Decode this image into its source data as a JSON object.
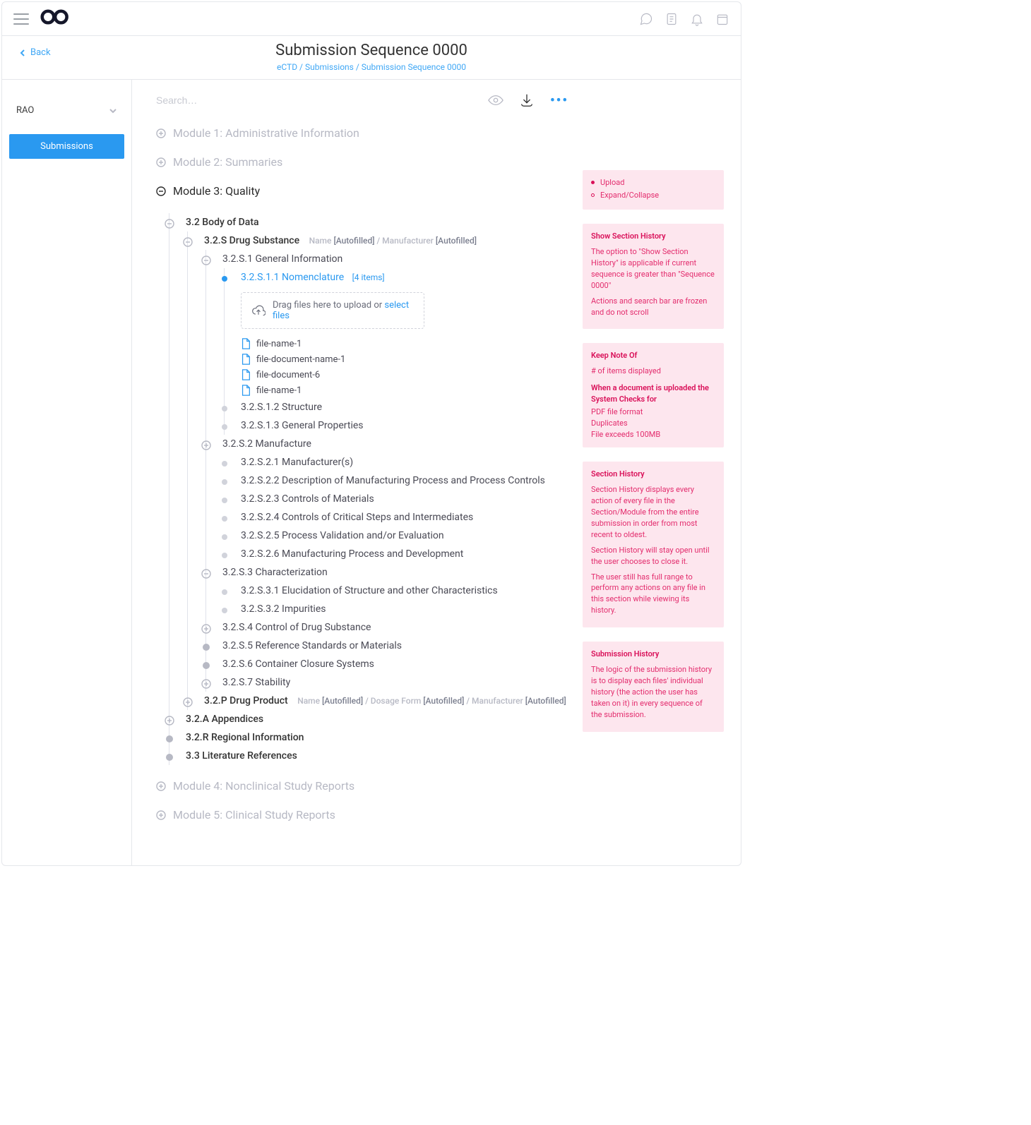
{
  "header": {
    "page_title": "Submission Sequence 0000",
    "breadcrumbs": "eCTD / Submissions / Submission Sequence 0000",
    "back_label": "Back"
  },
  "sidebar": {
    "project": "RAO",
    "nav": [
      "Submissions"
    ]
  },
  "toolbar": {
    "search_placeholder": "Search…"
  },
  "modules": {
    "m1": "Module 1: Administrative Information",
    "m2": "Module 2: Summaries",
    "m3": "Module 3: Quality",
    "m4": "Module 4: Nonclinical Study Reports",
    "m5": "Module 5: Clinical Study Reports"
  },
  "tree": {
    "l_3_2": "3.2 Body of Data",
    "l_3_2_s": "3.2.S Drug Substance",
    "l_3_2_s_meta1_label": "Name",
    "l_3_2_s_meta1_val": "[Autofilled]",
    "l_3_2_s_meta2_label": "Manufacturer",
    "l_3_2_s_meta2_val": "[Autofilled]",
    "l_3_2_s_1": "3.2.S.1 General Information",
    "l_3_2_s_1_1": "3.2.S.1.1 Nomenclature",
    "l_3_2_s_1_1_count": "[4 items]",
    "l_3_2_s_1_2": "3.2.S.1.2 Structure",
    "l_3_2_s_1_3": "3.2.S.1.3 General Properties",
    "l_3_2_s_2": "3.2.S.2 Manufacture",
    "l_3_2_s_2_1": "3.2.S.2.1 Manufacturer(s)",
    "l_3_2_s_2_2": "3.2.S.2.2 Description of Manufacturing Process and Process Controls",
    "l_3_2_s_2_3": "3.2.S.2.3 Controls of Materials",
    "l_3_2_s_2_4": "3.2.S.2.4 Controls of Critical Steps and Intermediates",
    "l_3_2_s_2_5": "3.2.S.2.5 Process Validation and/or Evaluation",
    "l_3_2_s_2_6": "3.2.S.2.6 Manufacturing Process and Development",
    "l_3_2_s_3": "3.2.S.3 Characterization",
    "l_3_2_s_3_1": "3.2.S.3.1 Elucidation of Structure and other Characteristics",
    "l_3_2_s_3_2": "3.2.S.3.2 Impurities",
    "l_3_2_s_4": "3.2.S.4 Control of Drug Substance",
    "l_3_2_s_5": "3.2.S.5 Reference Standards or Materials",
    "l_3_2_s_6": "3.2.S.6 Container Closure Systems",
    "l_3_2_s_7": "3.2.S.7 Stability",
    "l_3_2_p": "3.2.P Drug Product",
    "l_3_2_p_meta1_label": "Name",
    "l_3_2_p_meta1_val": "[Autofilled]",
    "l_3_2_p_meta2_label": "Dosage Form",
    "l_3_2_p_meta2_val": "[Autofilled]",
    "l_3_2_p_meta3_label": "Manufacturer",
    "l_3_2_p_meta3_val": "[Autofilled]",
    "l_3_2_a": "3.2.A Appendices",
    "l_3_2_r": "3.2.R Regional Information",
    "l_3_3": "3.3 Literature References"
  },
  "dropzone": {
    "text": "Drag files here to upload or ",
    "link": "select files"
  },
  "files": [
    "file-name-1",
    "file-document-name-1",
    "file-document-6",
    "file-name-1"
  ],
  "notes": {
    "n1_row1": "Upload",
    "n1_row2": "Expand/Collapse",
    "n2_title": "Show Section History",
    "n2_p1": "The option to \"Show Section History\" is applicable if current sequence is greater than \"Sequence 0000\"",
    "n2_p2": "Actions and search bar are frozen and do not scroll",
    "n3_title1": "Keep Note Of",
    "n3_p1": "# of items displayed",
    "n3_title2": "When a document is uploaded the System Checks for",
    "n3_p2": "PDF file format",
    "n3_p3": "Duplicates",
    "n3_p4": "File exceeds 100MB",
    "n4_title": "Section History",
    "n4_p1": "Section History displays every action of every file in the Section/Module from the entire submission in order from most recent to oldest.",
    "n4_p2": "Section History will stay open until the user chooses to close it.",
    "n4_p3": "The user still has full range to perform any actions on any file in this section while viewing its history.",
    "n5_title": "Submission History",
    "n5_p1": "The logic of the submission history is to display each files' individual history (the action the user has taken on it) in every sequence of the submission."
  }
}
